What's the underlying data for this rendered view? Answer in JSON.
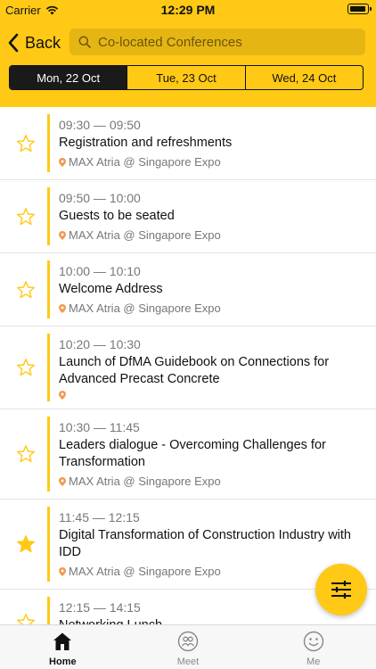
{
  "status_bar": {
    "carrier": "Carrier",
    "time": "12:29 PM"
  },
  "header": {
    "back_label": "Back",
    "search_placeholder": "Co-located Conferences",
    "days": [
      {
        "label": "Mon, 22 Oct",
        "active": true
      },
      {
        "label": "Tue, 23 Oct",
        "active": false
      },
      {
        "label": "Wed, 24 Oct",
        "active": false
      }
    ]
  },
  "sessions": [
    {
      "time": "09:30 — 09:50",
      "title": "Registration and refreshments",
      "location": "MAX Atria @ Singapore Expo",
      "starred": false
    },
    {
      "time": "09:50 — 10:00",
      "title": "Guests to be seated",
      "location": "MAX Atria @ Singapore Expo",
      "starred": false
    },
    {
      "time": "10:00 — 10:10",
      "title": "Welcome Address",
      "location": "MAX Atria @ Singapore Expo",
      "starred": false
    },
    {
      "time": "10:20 — 10:30",
      "title": "Launch of DfMA Guidebook on Connections for Advanced Precast Concrete",
      "location": "",
      "starred": false
    },
    {
      "time": "10:30 — 11:45",
      "title": "Leaders dialogue - Overcoming Challenges for Transformation",
      "location": "MAX Atria @ Singapore Expo",
      "starred": false
    },
    {
      "time": "11:45 — 12:15",
      "title": "Digital Transformation of Construction Industry with IDD",
      "location": "MAX Atria @ Singapore Expo",
      "starred": true
    },
    {
      "time": "12:15 — 14:15",
      "title": "Networking Lunch",
      "location": "",
      "starred": false
    }
  ],
  "fab": {
    "icon": "filter-sliders-icon"
  },
  "tab_bar": [
    {
      "label": "Home",
      "icon": "home-icon",
      "active": true
    },
    {
      "label": "Meet",
      "icon": "meet-icon",
      "active": false
    },
    {
      "label": "Me",
      "icon": "me-icon",
      "active": false
    }
  ],
  "colors": {
    "accent": "#FFC915",
    "search_bg": "#E5B514",
    "active_tab": "#1a1a1a",
    "location_pin": "#F2994A"
  }
}
